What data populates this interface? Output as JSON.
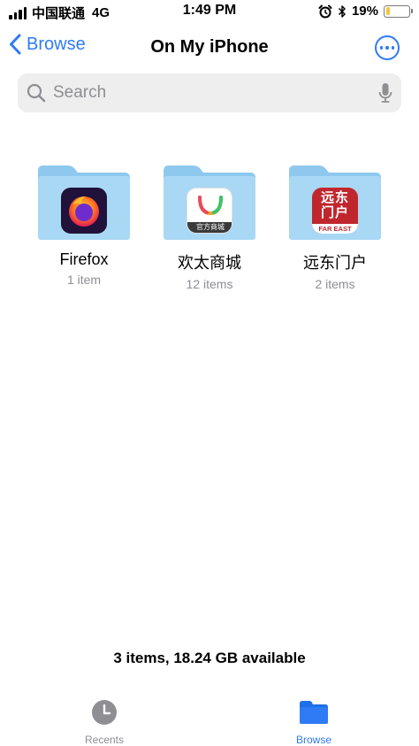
{
  "status_bar": {
    "carrier": "中国联通",
    "network": "4G",
    "time": "1:49 PM",
    "battery_percent": "19%",
    "battery_level": 0.19
  },
  "nav": {
    "back_label": "Browse",
    "title": "On My iPhone"
  },
  "search": {
    "placeholder": "Search"
  },
  "folders": [
    {
      "name": "Firefox",
      "count": "1 item",
      "icon": "firefox-icon"
    },
    {
      "name": "欢太商城",
      "count": "12 items",
      "icon": "heytap-store-icon",
      "icon_text": "官方商城"
    },
    {
      "name": "远东门户",
      "count": "2 items",
      "icon": "far-east-portal-icon",
      "icon_text_top": "远东",
      "icon_text_mid": "门户",
      "icon_text_bottom": "FAR EAST"
    }
  ],
  "footer": {
    "storage_summary": "3 items, 18.24 GB available"
  },
  "tabs": [
    {
      "label": "Recents",
      "icon": "clock-icon",
      "active": false
    },
    {
      "label": "Browse",
      "icon": "folder-icon",
      "active": true
    }
  ],
  "colors": {
    "accent": "#2f7bf6",
    "folder": "#a9d8f5",
    "folder_tab": "#8ec8ee",
    "inactive_tab": "#8e8e93",
    "battery": "#f5c542"
  }
}
